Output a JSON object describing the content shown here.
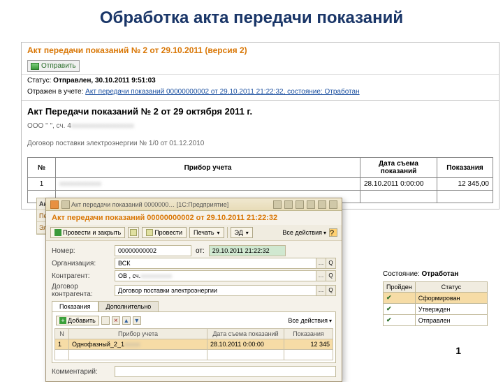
{
  "slide": {
    "title": "Обработка акта передачи показаний",
    "page": "1"
  },
  "main": {
    "title": "Акт передачи показаний № 2 от 29.10.2011 (версия 2)",
    "send_label": "Отправить",
    "status_prefix": "Статус:",
    "status": "Отправлен, 30.10.2011 9:51:03",
    "reflected_prefix": "Отражен в учете:",
    "link": "Акт передачи показаний 00000000002 от 29.10.2011 21:22:32, состояние: Отработан",
    "doc_title": "Акт Передачи показаний № 2 от 29 октября 2011 г.",
    "org_line": "ООО \"                       \", сч. 4",
    "contract": "Договор поставки электроэнергии № 1/0 от 01.12.2010",
    "cols": {
      "n": "№",
      "device": "Прибор учета",
      "date": "Дата съема показаний",
      "value": "Показания"
    },
    "row": {
      "n": "1",
      "device": "",
      "date": "28.10.2011 0:00:00",
      "value": "12 345,00"
    }
  },
  "side": {
    "t0": "Акт…",
    "t1": "Перей",
    "t2": "Элек…"
  },
  "sub": {
    "wintitle": "Акт передачи показаний 0000000…  [1С:Предприятие]",
    "header": "Акт передачи показаний 00000000002 от 29.10.2011 21:22:32",
    "btn_post_close": "Провести и закрыть",
    "btn_post": "Провести",
    "btn_print": "Печать",
    "btn_ed": "ЭД",
    "all_actions": "Все действия",
    "labels": {
      "number": "Номер:",
      "from": "от:",
      "org": "Организация:",
      "counter": "Контрагент:",
      "contract": "Договор контрагента:",
      "comment": "Комментарий:"
    },
    "number": "00000000002",
    "date": "29.10.2011 21:22:32",
    "org": "ВСК",
    "counter": "ОВ                          , сч.",
    "contract": "Договор поставки электроэнергии",
    "tabs": {
      "t1": "Показания",
      "t2": "Дополнительно"
    },
    "add": "Добавить",
    "grid_cols": {
      "n": "N",
      "device": "Прибор учета",
      "date": "Дата съема показаний",
      "value": "Показания"
    },
    "grid_row": {
      "n": "1",
      "device": "Однофазный_2_1",
      "date": "28.10.2011 0:00:00",
      "value": "12 345"
    }
  },
  "status_block": {
    "label_prefix": "Состояние:",
    "label": "Отработан",
    "cols": {
      "c1": "Пройден",
      "c2": "Статус"
    },
    "rows": [
      {
        "p": "✔",
        "s": "Сформирован"
      },
      {
        "p": "✔",
        "s": "Утвержден"
      },
      {
        "p": "✔",
        "s": "Отправлен"
      }
    ]
  }
}
